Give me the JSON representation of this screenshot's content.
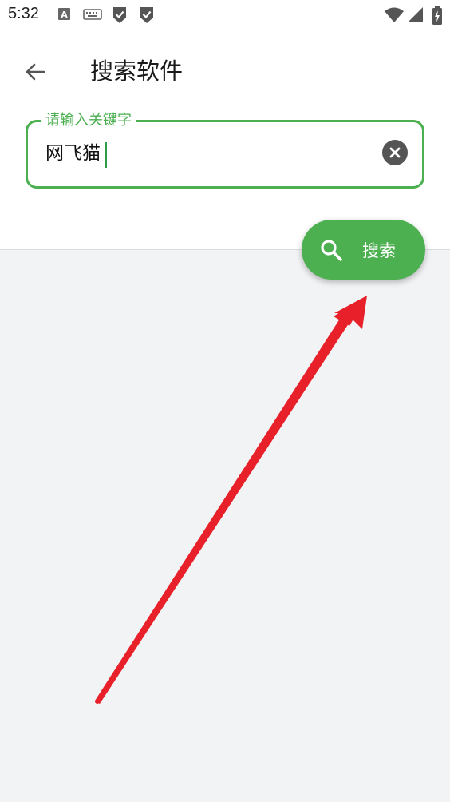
{
  "status_bar": {
    "time": "5:32"
  },
  "header": {
    "title": "搜索软件",
    "back_icon": "arrow-left-icon"
  },
  "search": {
    "label": "请输入关键字",
    "value": "网飞猫",
    "clear_icon": "close-circle-icon"
  },
  "search_button": {
    "label": "搜索",
    "icon": "search-icon"
  },
  "colors": {
    "accent": "#4caf50",
    "annotation_arrow": "#e8202a",
    "background": "#f2f3f5"
  }
}
